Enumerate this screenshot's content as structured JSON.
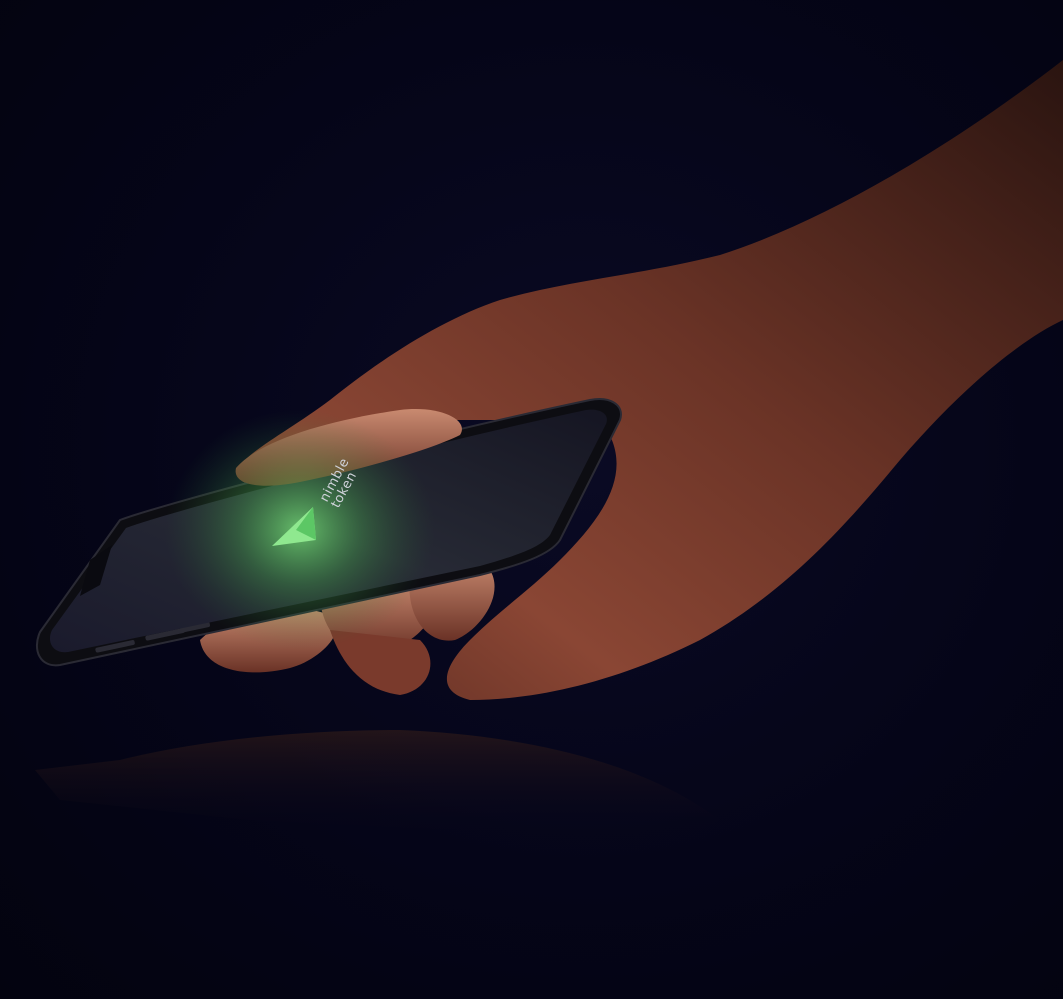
{
  "brand": {
    "line1": "nimble",
    "line2": "token"
  },
  "colors": {
    "background": "#04041a",
    "glow": "#6fe37a",
    "logo": "#8fe88f",
    "skin": "#b8735e",
    "phone_body": "#101014",
    "screen": "#1b1b2a"
  },
  "icons": {
    "logo": "triangle-logo-icon"
  }
}
